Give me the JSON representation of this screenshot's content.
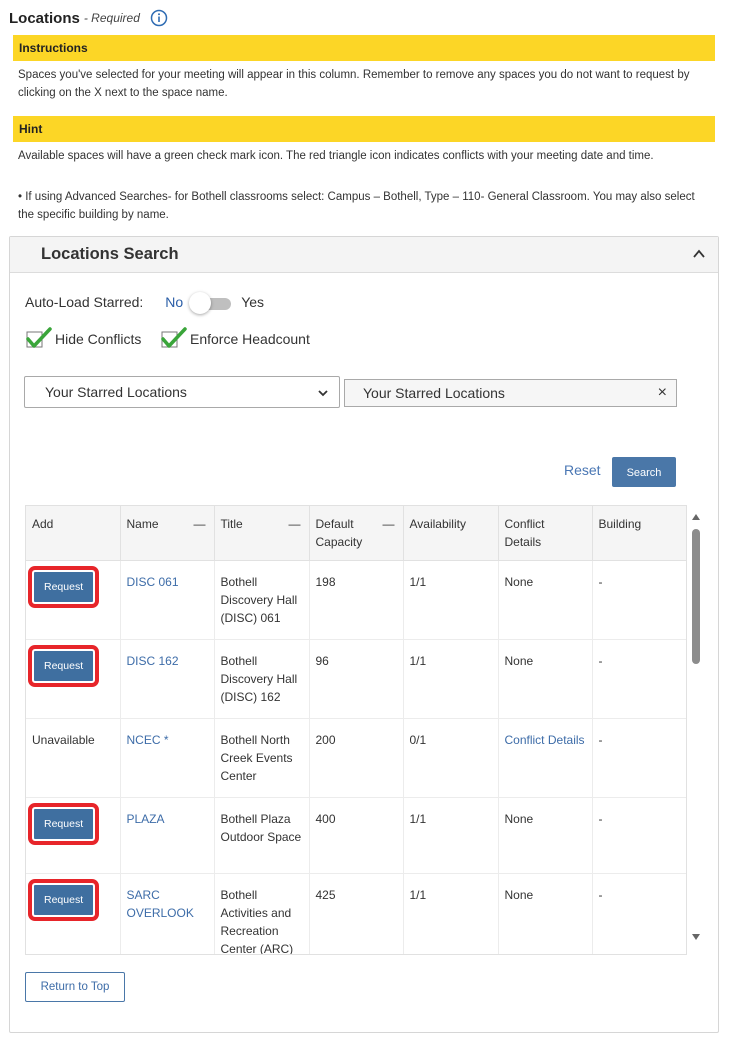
{
  "header": {
    "title": "Locations",
    "required_label": "- Required",
    "info_icon": "info-icon"
  },
  "instructions": {
    "heading": "Instructions",
    "text": "Spaces you've selected for your meeting will appear in this column. Remember to remove any spaces you do not want to request by clicking on the X next to the space name."
  },
  "hint": {
    "heading": "Hint",
    "text1": "Available spaces will have a green check mark icon. The red triangle icon indicates conflicts with your meeting date and time.",
    "text2": "•  If using Advanced Searches- for Bothell classrooms select: Campus – Bothell, Type – 110- General Classroom. You may also select the specific building by name."
  },
  "panel": {
    "title": "Locations Search",
    "autoload_label": "Auto-Load Starred:",
    "autoload_no": "No",
    "autoload_yes": "Yes",
    "hide_conflicts_label": "Hide Conflicts",
    "enforce_headcount_label": "Enforce Headcount",
    "select_value": "Your Starred Locations",
    "chip_value": "Your Starred Locations",
    "chip_remove": "×",
    "reset_label": "Reset",
    "search_label": "Search",
    "return_label": "Return to Top"
  },
  "table": {
    "columns": [
      "Add",
      "Name",
      "Title",
      "Default Capacity",
      "Availability",
      "Conflict Details",
      "Building"
    ],
    "header_dash": "—",
    "rows": [
      {
        "add": "Request",
        "name": "DISC 061",
        "title": "Bothell Discovery Hall (DISC) 061",
        "capacity": "198",
        "availability": "1/1",
        "conflict": "None",
        "building": "-"
      },
      {
        "add": "Request",
        "name": "DISC 162",
        "title": "Bothell Discovery Hall (DISC) 162",
        "capacity": "96",
        "availability": "1/1",
        "conflict": "None",
        "building": "-"
      },
      {
        "add": "Unavailable",
        "name": "NCEC *",
        "title": "Bothell North Creek Events Center",
        "capacity": "200",
        "availability": "0/1",
        "conflict": "Conflict Details",
        "building": "-"
      },
      {
        "add": "Request",
        "name": "PLAZA",
        "title": "Bothell Plaza Outdoor Space",
        "capacity": "400",
        "availability": "1/1",
        "conflict": "None",
        "building": "-"
      },
      {
        "add": "Request",
        "name": "SARC OVERLOOK",
        "title": "Bothell Activities and Recreation Center (ARC) Overlook",
        "capacity": "425",
        "availability": "1/1",
        "conflict": "None",
        "building": "-"
      }
    ]
  },
  "colors": {
    "yellow": "#fcd626",
    "button_blue": "#4a77a8",
    "highlight_red": "#e7252a",
    "link_blue": "#3d6ca8",
    "check_green": "#3aa53a"
  }
}
